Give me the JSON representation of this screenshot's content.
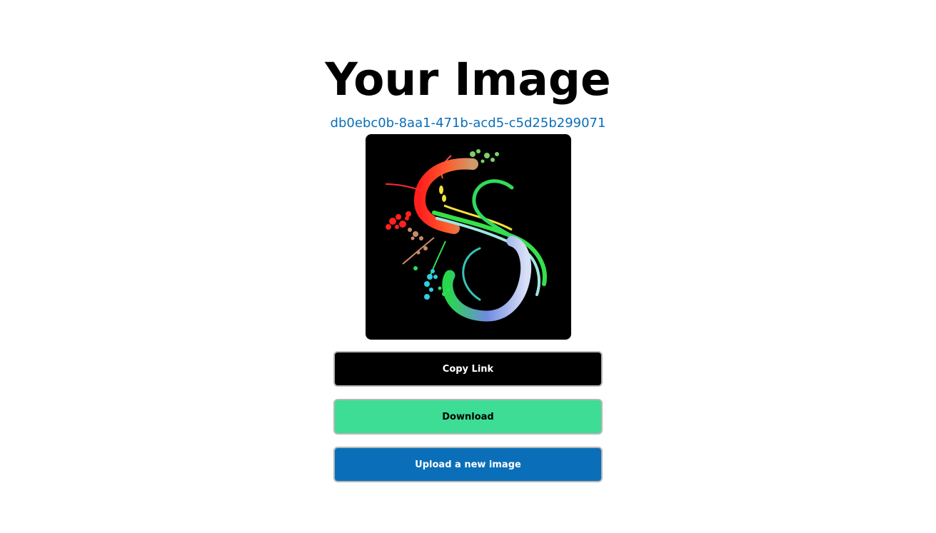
{
  "page": {
    "title": "Your Image",
    "image_id": "db0ebc0b-8aa1-471b-acd5-c5d25b299071"
  },
  "image": {
    "icon": "rainbow-floral-s-artwork",
    "background_color": "#000000"
  },
  "buttons": {
    "copy_link": {
      "label": "Copy Link",
      "color": "#000000"
    },
    "download": {
      "label": "Download",
      "color": "#3ddd95"
    },
    "upload": {
      "label": "Upload a new image",
      "color": "#0a6fb8"
    }
  },
  "colors": {
    "link": "#0a6fb8"
  }
}
